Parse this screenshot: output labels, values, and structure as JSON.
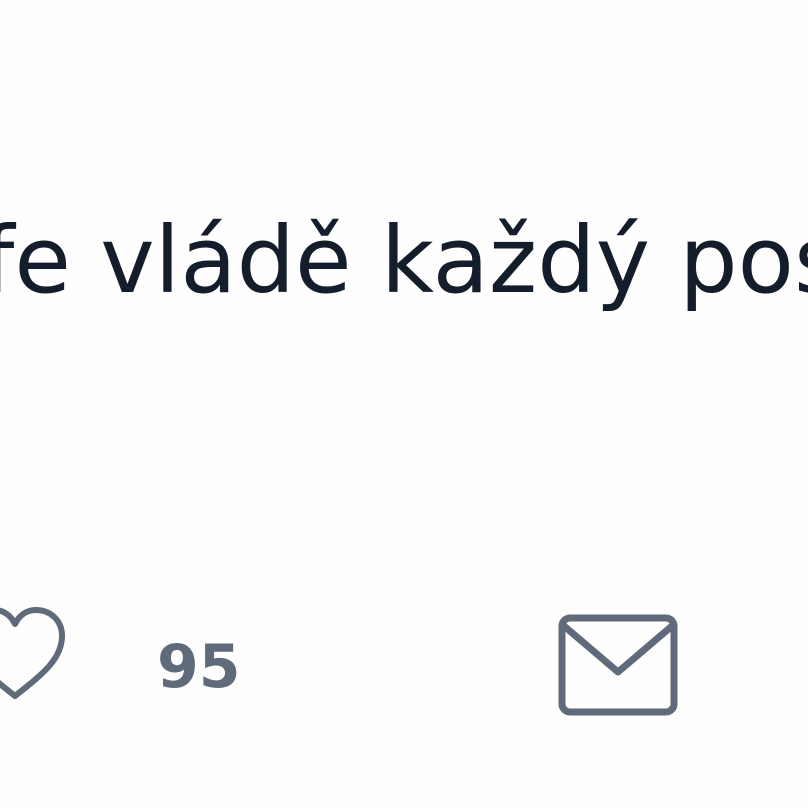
{
  "post": {
    "text": "fe vládě každý pos"
  },
  "actions": {
    "like_icon": "heart-outline-icon",
    "like_count": "95",
    "message_icon": "envelope-icon",
    "icon_color": "#5f6b7a"
  }
}
